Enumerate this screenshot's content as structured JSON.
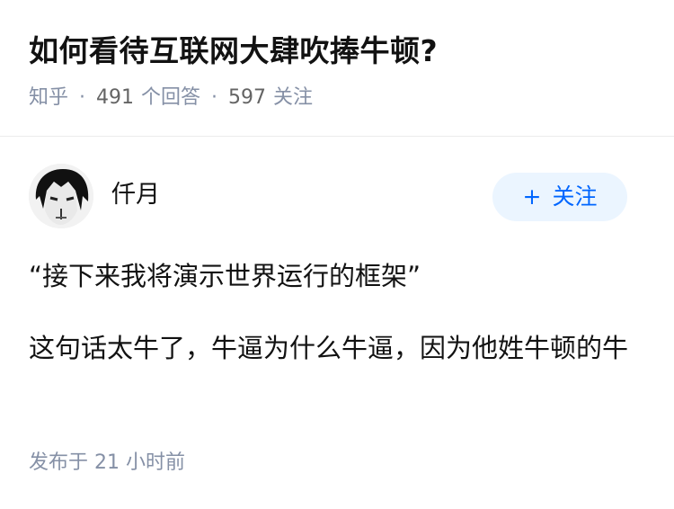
{
  "question": {
    "title": "如何看待互联网大肆吹捧牛顿?",
    "source": "知乎",
    "separator": "·",
    "answer_count": "491",
    "answer_label": "个回答",
    "follower_count": "597",
    "follower_label": "关注"
  },
  "author": {
    "name": "仟月",
    "follow_plus": "+",
    "follow_label": "关注"
  },
  "answer": {
    "paragraphs": [
      "“接下来我将演示世界运行的框架”",
      "这句话太牛了，牛逼为什么牛逼，因为他姓牛顿的牛"
    ],
    "published": "发布于  21 小时前"
  },
  "colors": {
    "accent": "#0066ff",
    "button_bg": "#ebf5ff",
    "meta_gray": "#8590a6"
  },
  "icons": {
    "avatar": "user-avatar"
  }
}
